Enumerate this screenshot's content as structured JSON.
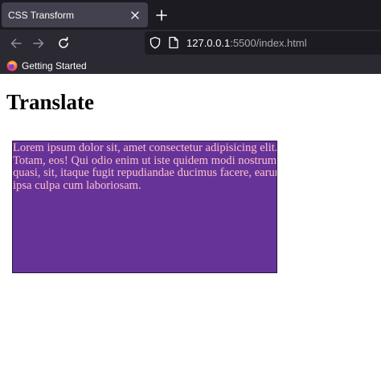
{
  "browser": {
    "tab": {
      "title": "CSS Transform"
    },
    "url": {
      "host": "127.0.0.1",
      "path": ":5500/index.html"
    },
    "bookmarks": [
      {
        "label": "Getting Started"
      }
    ]
  },
  "page": {
    "heading": "Translate",
    "box": {
      "text": "Lorem ipsum dolor sit, amet consectetur adipisicing elit. Totam, eos! Qui odio enim ut iste quidem modi nostrum quasi, sit, itaque fugit repudiandae ducimus facere, earum ipsa culpa cum laboriosam.",
      "background": "#663399",
      "text_color": "#ffc0cb"
    }
  },
  "colors": {
    "tabstrip": "#1c1b22",
    "toolbar": "#2b2a33",
    "active_tab": "#42414d"
  },
  "icons": {
    "tab_close": "close-icon",
    "new_tab": "plus-icon",
    "back": "arrow-left-icon",
    "forward": "arrow-right-icon",
    "reload": "reload-icon",
    "tracking": "shield-icon",
    "page": "page-icon",
    "bookmark": "firefox-icon"
  }
}
